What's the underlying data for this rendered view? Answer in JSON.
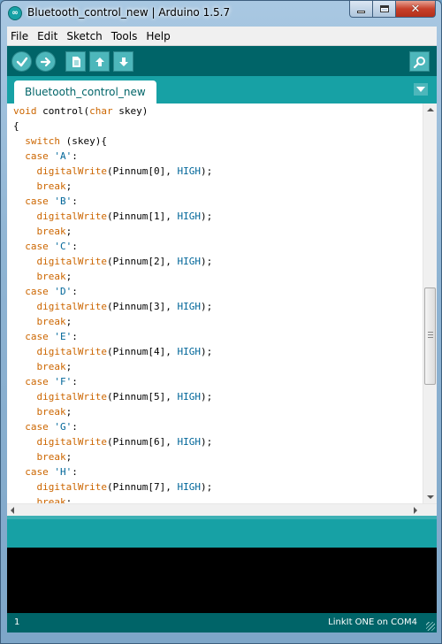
{
  "window": {
    "title": "Bluetooth_control_new | Arduino 1.5.7",
    "app_icon": "arduino-icon",
    "buttons": [
      "minimize-icon",
      "maximize-icon",
      "close-icon"
    ]
  },
  "menu": {
    "items": [
      "File",
      "Edit",
      "Sketch",
      "Tools",
      "Help"
    ]
  },
  "toolbar": {
    "buttons": [
      {
        "name": "verify",
        "icon": "check-icon"
      },
      {
        "name": "upload",
        "icon": "arrow-right-icon"
      },
      {
        "name": "new",
        "icon": "document-icon"
      },
      {
        "name": "open",
        "icon": "arrow-up-icon"
      },
      {
        "name": "save",
        "icon": "arrow-down-icon"
      }
    ],
    "serial_monitor_icon": "magnifier-icon"
  },
  "tabs": {
    "active": "Bluetooth_control_new",
    "menu_icon": "triangle-down-icon"
  },
  "editor": {
    "lines": [
      [
        [
          "kw",
          "void"
        ],
        [
          "t",
          " control("
        ],
        [
          "kw",
          "char"
        ],
        [
          "t",
          " skey)"
        ]
      ],
      [
        [
          "t",
          "{"
        ]
      ],
      [
        [
          "t",
          "  "
        ],
        [
          "kw",
          "switch"
        ],
        [
          "t",
          " (skey){"
        ]
      ],
      [
        [
          "t",
          "  "
        ],
        [
          "kw",
          "case"
        ],
        [
          "t",
          " "
        ],
        [
          "str",
          "'A'"
        ],
        [
          "t",
          ":"
        ]
      ],
      [
        [
          "t",
          "    "
        ],
        [
          "kw",
          "digitalWrite"
        ],
        [
          "t",
          "(Pinnum[0], "
        ],
        [
          "const",
          "HIGH"
        ],
        [
          "t",
          ");"
        ]
      ],
      [
        [
          "t",
          "    "
        ],
        [
          "kw",
          "break"
        ],
        [
          "t",
          ";"
        ]
      ],
      [
        [
          "t",
          "  "
        ],
        [
          "kw",
          "case"
        ],
        [
          "t",
          " "
        ],
        [
          "str",
          "'B'"
        ],
        [
          "t",
          ":"
        ]
      ],
      [
        [
          "t",
          "    "
        ],
        [
          "kw",
          "digitalWrite"
        ],
        [
          "t",
          "(Pinnum[1], "
        ],
        [
          "const",
          "HIGH"
        ],
        [
          "t",
          ");"
        ]
      ],
      [
        [
          "t",
          "    "
        ],
        [
          "kw",
          "break"
        ],
        [
          "t",
          ";"
        ]
      ],
      [
        [
          "t",
          "  "
        ],
        [
          "kw",
          "case"
        ],
        [
          "t",
          " "
        ],
        [
          "str",
          "'C'"
        ],
        [
          "t",
          ":"
        ]
      ],
      [
        [
          "t",
          "    "
        ],
        [
          "kw",
          "digitalWrite"
        ],
        [
          "t",
          "(Pinnum[2], "
        ],
        [
          "const",
          "HIGH"
        ],
        [
          "t",
          ");"
        ]
      ],
      [
        [
          "t",
          "    "
        ],
        [
          "kw",
          "break"
        ],
        [
          "t",
          ";"
        ]
      ],
      [
        [
          "t",
          "  "
        ],
        [
          "kw",
          "case"
        ],
        [
          "t",
          " "
        ],
        [
          "str",
          "'D'"
        ],
        [
          "t",
          ":"
        ]
      ],
      [
        [
          "t",
          "    "
        ],
        [
          "kw",
          "digitalWrite"
        ],
        [
          "t",
          "(Pinnum[3], "
        ],
        [
          "const",
          "HIGH"
        ],
        [
          "t",
          ");"
        ]
      ],
      [
        [
          "t",
          "    "
        ],
        [
          "kw",
          "break"
        ],
        [
          "t",
          ";"
        ]
      ],
      [
        [
          "t",
          "  "
        ],
        [
          "kw",
          "case"
        ],
        [
          "t",
          " "
        ],
        [
          "str",
          "'E'"
        ],
        [
          "t",
          ":"
        ]
      ],
      [
        [
          "t",
          "    "
        ],
        [
          "kw",
          "digitalWrite"
        ],
        [
          "t",
          "(Pinnum[4], "
        ],
        [
          "const",
          "HIGH"
        ],
        [
          "t",
          ");"
        ]
      ],
      [
        [
          "t",
          "    "
        ],
        [
          "kw",
          "break"
        ],
        [
          "t",
          ";"
        ]
      ],
      [
        [
          "t",
          "  "
        ],
        [
          "kw",
          "case"
        ],
        [
          "t",
          " "
        ],
        [
          "str",
          "'F'"
        ],
        [
          "t",
          ":"
        ]
      ],
      [
        [
          "t",
          "    "
        ],
        [
          "kw",
          "digitalWrite"
        ],
        [
          "t",
          "(Pinnum[5], "
        ],
        [
          "const",
          "HIGH"
        ],
        [
          "t",
          ");"
        ]
      ],
      [
        [
          "t",
          "    "
        ],
        [
          "kw",
          "break"
        ],
        [
          "t",
          ";"
        ]
      ],
      [
        [
          "t",
          "  "
        ],
        [
          "kw",
          "case"
        ],
        [
          "t",
          " "
        ],
        [
          "str",
          "'G'"
        ],
        [
          "t",
          ":"
        ]
      ],
      [
        [
          "t",
          "    "
        ],
        [
          "kw",
          "digitalWrite"
        ],
        [
          "t",
          "(Pinnum[6], "
        ],
        [
          "const",
          "HIGH"
        ],
        [
          "t",
          ");"
        ]
      ],
      [
        [
          "t",
          "    "
        ],
        [
          "kw",
          "break"
        ],
        [
          "t",
          ";"
        ]
      ],
      [
        [
          "t",
          "  "
        ],
        [
          "kw",
          "case"
        ],
        [
          "t",
          " "
        ],
        [
          "str",
          "'H'"
        ],
        [
          "t",
          ":"
        ]
      ],
      [
        [
          "t",
          "    "
        ],
        [
          "kw",
          "digitalWrite"
        ],
        [
          "t",
          "(Pinnum[7], "
        ],
        [
          "const",
          "HIGH"
        ],
        [
          "t",
          ");"
        ]
      ],
      [
        [
          "t",
          "    "
        ],
        [
          "kw",
          "break"
        ],
        [
          "t",
          ";"
        ]
      ]
    ],
    "colors": {
      "keyword": "#cc6600",
      "constant": "#006699",
      "text": "#000000"
    }
  },
  "status": {
    "line_number": "1",
    "board": "LinkIt ONE on COM4"
  },
  "colors": {
    "toolbar_bg": "#006468",
    "tab_strip_bg": "#17a1a5",
    "button_bg": "#4db7bb",
    "console_bg": "#000000"
  }
}
